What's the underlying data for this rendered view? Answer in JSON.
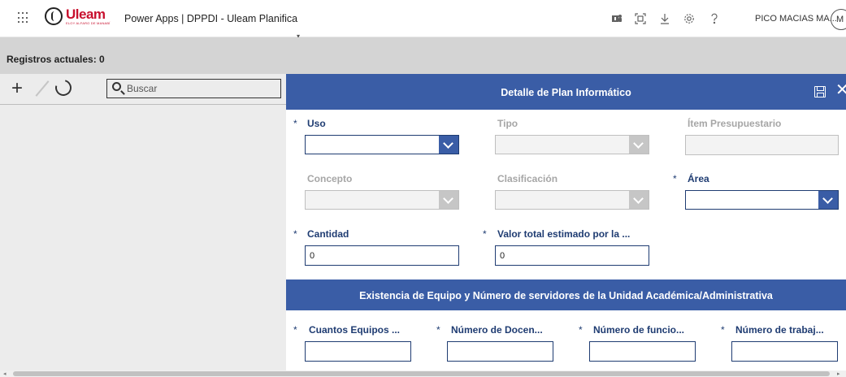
{
  "header": {
    "logo_text": "Uleam",
    "logo_subtext": "ELOY ALFARO DE MANABÍ",
    "app_title": "Power Apps  |  DPPDI - Uleam Planifica",
    "user_name": "PICO MACIAS MA...",
    "avatar_initial": "M",
    "icons": [
      "app-launcher-icon",
      "teams-icon",
      "fit-screen-icon",
      "download-icon",
      "settings-icon",
      "help-icon"
    ]
  },
  "records": {
    "label": "Registros actuales: 0"
  },
  "gallery": {
    "search_placeholder": "Buscar",
    "toolbar_icons": [
      "add-icon",
      "edit-icon",
      "refresh-icon",
      "search-icon"
    ]
  },
  "form": {
    "title": "Detalle de Plan Informático",
    "header_icons": [
      "save-icon",
      "close-icon"
    ],
    "required_marker": "*",
    "fields": {
      "uso": {
        "label": "Uso",
        "required": true
      },
      "tipo": {
        "label": "Tipo",
        "required": false
      },
      "item": {
        "label": "Ítem Presupuestario",
        "required": false
      },
      "concepto": {
        "label": "Concepto",
        "required": false
      },
      "clasificacion": {
        "label": "Clasificación",
        "required": false
      },
      "area": {
        "label": "Área",
        "required": true
      },
      "cantidad": {
        "label": "Cantidad",
        "required": true,
        "value": "0"
      },
      "valor": {
        "label": "Valor total estimado por la ...",
        "required": true,
        "value": "0"
      }
    },
    "section": {
      "title": "Existencia de Equipo y Número de servidores de la Unidad Académica/Administrativa",
      "fields": [
        {
          "label": "Cuantos Equipos ...",
          "value": ""
        },
        {
          "label": "Número de Docen...",
          "value": ""
        },
        {
          "label": "Número de funcio...",
          "value": ""
        },
        {
          "label": "Número de trabaj...",
          "value": ""
        }
      ]
    }
  },
  "colors": {
    "primary": "#3a5da6",
    "label": "#1f3c72",
    "disabled": "#a6a6a6",
    "brand_red": "#c8102e"
  }
}
